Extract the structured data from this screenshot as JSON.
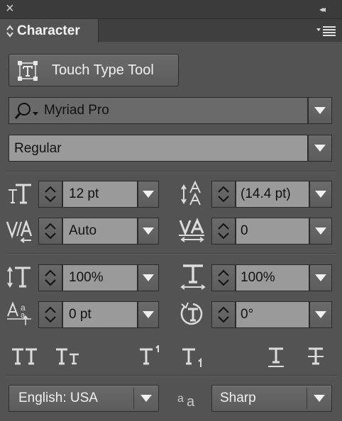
{
  "panel": {
    "title": "Character",
    "close_glyph": "×",
    "collapse_glyph": "◂◂"
  },
  "touch_type": {
    "label": "Touch Type Tool"
  },
  "font": {
    "family": "Myriad Pro",
    "style": "Regular"
  },
  "fields": {
    "font_size": "12 pt",
    "leading": "(14.4 pt)",
    "kerning": "Auto",
    "tracking": "0",
    "vertical_scale": "100%",
    "horizontal_scale": "100%",
    "baseline_shift": "0 pt",
    "rotation": "0°"
  },
  "bottom": {
    "language": "English: USA",
    "antialias": "Sharp"
  },
  "colors": {
    "panel_bg": "#535353",
    "field_bg": "#9a9a9a",
    "titlebar": "#3b3b3b"
  }
}
